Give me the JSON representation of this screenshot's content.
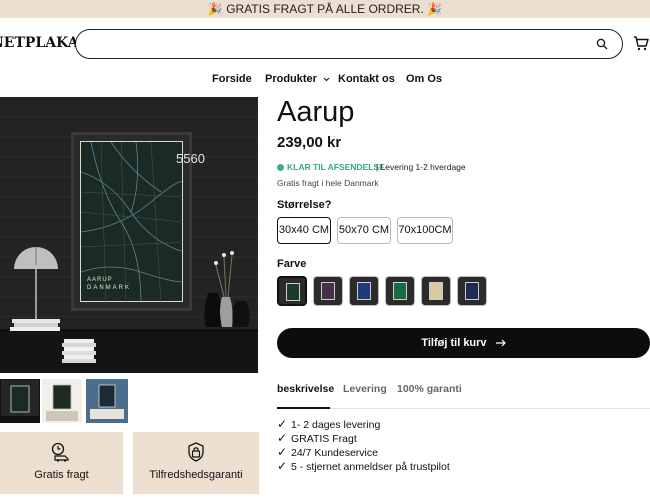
{
  "announcement": {
    "text": "🎉 GRATIS FRAGT PÅ ALLE ORDRER. 🎉"
  },
  "header": {
    "logo": "NETPLAKATER",
    "search_placeholder": "",
    "search_icon": "search-icon",
    "cart_icon": "cart-icon"
  },
  "nav": {
    "items": [
      {
        "label": "Forside"
      },
      {
        "label": "Produkter"
      },
      {
        "label": "Kontakt os"
      },
      {
        "label": "Om Os"
      }
    ]
  },
  "hero": {
    "poster_number": "5560",
    "poster_title": "AARUP",
    "poster_subtitle": "DANMARK"
  },
  "features": [
    {
      "label": "Gratis fragt",
      "icon": "truck-clock-icon"
    },
    {
      "label": "Tilfredshedsgaranti",
      "icon": "lock-shield-icon"
    }
  ],
  "product": {
    "title": "Aarup",
    "price": "239,00 kr",
    "stock_status": "KLAR TIL AFSENDELSE",
    "stock_info": "| Levering 1-2 hverdage",
    "shipping_note": "Gratis fragt i hele Danmark",
    "size_label": "Størrelse?",
    "sizes": [
      {
        "label": "30x40 CM"
      },
      {
        "label": "50x70 CM"
      },
      {
        "label": "70x100CM"
      }
    ],
    "selected_size": "30x40 CM",
    "color_label": "Farve",
    "colors": [
      "#1e3a2a",
      "#4a2f4a",
      "#1f3c78",
      "#1c6b3e",
      "#d9c9a0",
      "#1c2c55"
    ],
    "add_to_cart": "Tilføj til kurv",
    "tabs": [
      {
        "label": "beskrivelse"
      },
      {
        "label": "Levering"
      },
      {
        "label": "100% garanti"
      }
    ],
    "checklist": [
      {
        "text": "1- 2 dages levering"
      },
      {
        "text": "GRATIS Fragt"
      },
      {
        "text": "24/7 Kundeservice"
      },
      {
        "text": "5 - stjernet anmeldser på trustpilot"
      }
    ],
    "tick_glyph": "✓"
  }
}
